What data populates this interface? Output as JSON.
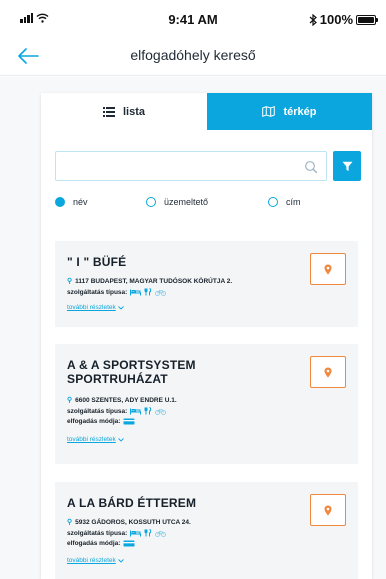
{
  "status_bar": {
    "time": "9:41 AM",
    "battery": "100%",
    "battery_level": 1.0
  },
  "header": {
    "title": "elfogadóhely kereső",
    "back_icon": "arrow-left-icon"
  },
  "tabs": [
    {
      "label": "lista",
      "icon": "list-icon",
      "active": true
    },
    {
      "label": "térkép",
      "icon": "map-icon",
      "active": false
    }
  ],
  "search": {
    "value": "",
    "placeholder": ""
  },
  "radios": [
    {
      "label": "név",
      "checked": true
    },
    {
      "label": "üzemeltető",
      "checked": false
    },
    {
      "label": "cím",
      "checked": false
    }
  ],
  "results": [
    {
      "title": "\" I \" BÜFÉ",
      "address": "1117 BUDAPEST, MAGYAR TUDÓSOK KÖRÚTJA 2.",
      "service_label": "szolgáltatás típusa:",
      "payment_label": "",
      "more": "további részletek"
    },
    {
      "title": "A & A SPORTSYSTEM SPORTRUHÁZAT",
      "address": "6600 SZENTES, ADY ENDRE U.1.",
      "service_label": "szolgáltatás típusa:",
      "payment_label": "elfogadás módja:",
      "more": "további részletek"
    },
    {
      "title": "A LA BÁRD ÉTTEREM",
      "address": "5932 GÁDOROS, KOSSUTH UTCA 24.",
      "service_label": "szolgáltatás típusa:",
      "payment_label": "elfogadás módja:",
      "more": "további részletek"
    }
  ],
  "colors": {
    "accent": "#0aa6dd",
    "pin_border": "#f0883e",
    "card_bg": "#f4f5f6"
  }
}
